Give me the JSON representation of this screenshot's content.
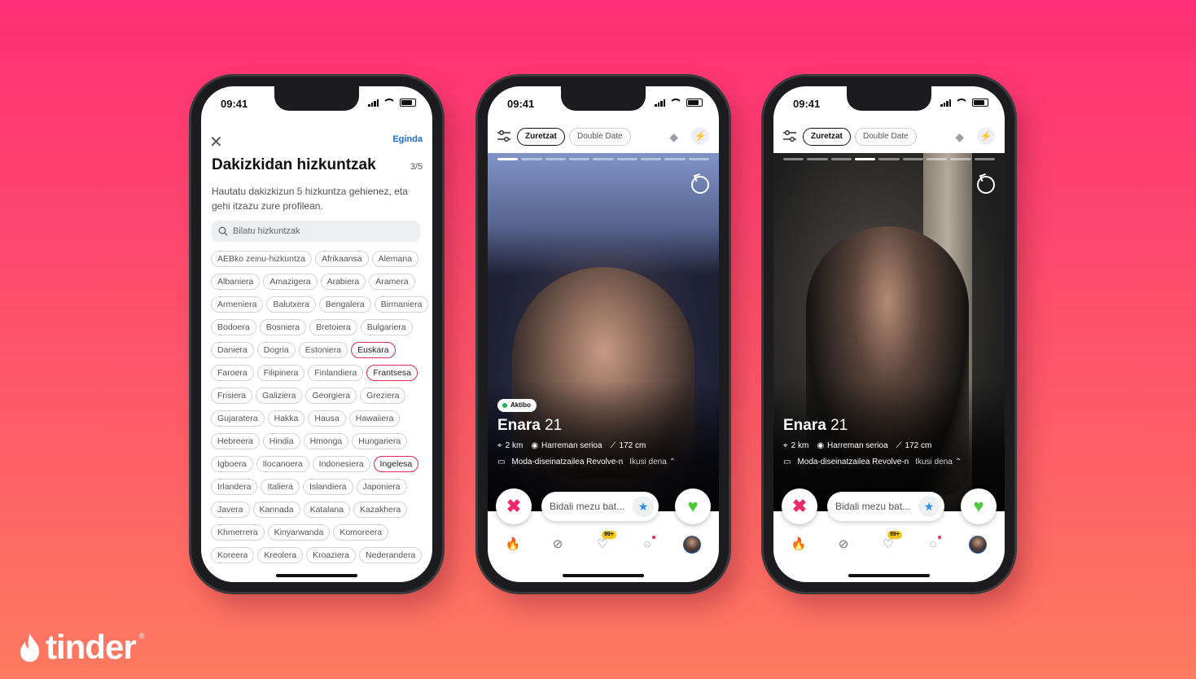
{
  "brand": {
    "wordmark": "tinder",
    "registered": "®"
  },
  "status": {
    "time": "09:41"
  },
  "languages_screen": {
    "close": "✕",
    "done": "Egindа",
    "title": "Dakizkidan hizkuntzak",
    "counter": "3/5",
    "description": "Hautatu dakizkizun 5 hizkuntza gehienez, eta gehi itzazu zure profilean.",
    "search_placeholder": "Bilatu hizkuntzak",
    "languages": [
      {
        "label": "AEBko zeinu-hizkuntza",
        "selected": false
      },
      {
        "label": "Afrikaansa",
        "selected": false
      },
      {
        "label": "Alemana",
        "selected": false
      },
      {
        "label": "Albaniera",
        "selected": false
      },
      {
        "label": "Amazigera",
        "selected": false
      },
      {
        "label": "Arabiera",
        "selected": false
      },
      {
        "label": "Aramera",
        "selected": false
      },
      {
        "label": "Armeniera",
        "selected": false
      },
      {
        "label": "Balutxera",
        "selected": false
      },
      {
        "label": "Bengalera",
        "selected": false
      },
      {
        "label": "Birmaniera",
        "selected": false
      },
      {
        "label": "Bodoera",
        "selected": false
      },
      {
        "label": "Bosniera",
        "selected": false
      },
      {
        "label": "Bretoiera",
        "selected": false
      },
      {
        "label": "Bulgariera",
        "selected": false
      },
      {
        "label": "Daniera",
        "selected": false
      },
      {
        "label": "Dogria",
        "selected": false
      },
      {
        "label": "Estoniera",
        "selected": false
      },
      {
        "label": "Euskara",
        "selected": true
      },
      {
        "label": "Faroera",
        "selected": false
      },
      {
        "label": "Filipinera",
        "selected": false
      },
      {
        "label": "Finlandiera",
        "selected": false
      },
      {
        "label": "Frantsesa",
        "selected": true
      },
      {
        "label": "Frisiera",
        "selected": false
      },
      {
        "label": "Galiziera",
        "selected": false
      },
      {
        "label": "Georgiera",
        "selected": false
      },
      {
        "label": "Greziera",
        "selected": false
      },
      {
        "label": "Gujaratera",
        "selected": false
      },
      {
        "label": "Hakka",
        "selected": false
      },
      {
        "label": "Hausa",
        "selected": false
      },
      {
        "label": "Hawaiiera",
        "selected": false
      },
      {
        "label": "Hebreera",
        "selected": false
      },
      {
        "label": "Hindia",
        "selected": false
      },
      {
        "label": "Hmonga",
        "selected": false
      },
      {
        "label": "Hungariera",
        "selected": false
      },
      {
        "label": "Igboera",
        "selected": false
      },
      {
        "label": "Ilocanoera",
        "selected": false
      },
      {
        "label": "Indonesiera",
        "selected": false
      },
      {
        "label": "Ingelesa",
        "selected": true
      },
      {
        "label": "Irlandera",
        "selected": false
      },
      {
        "label": "Italiera",
        "selected": false
      },
      {
        "label": "Islandiera",
        "selected": false
      },
      {
        "label": "Japoniera",
        "selected": false
      },
      {
        "label": "Javera",
        "selected": false
      },
      {
        "label": "Kannada",
        "selected": false
      },
      {
        "label": "Katalana",
        "selected": false
      },
      {
        "label": "Kazakhera",
        "selected": false
      },
      {
        "label": "Khmerrera",
        "selected": false
      },
      {
        "label": "Kinyarwanda",
        "selected": false
      },
      {
        "label": "Komoreera",
        "selected": false
      },
      {
        "label": "Koreera",
        "selected": false
      },
      {
        "label": "Kreolera",
        "selected": false
      },
      {
        "label": "Kroaziera",
        "selected": false
      },
      {
        "label": "Nederandera",
        "selected": false
      }
    ]
  },
  "profile_screen": {
    "tab_active": "Zuretzat",
    "tab_inactive": "Double Date",
    "active_badge": "Aktibo",
    "name": "Enara",
    "age": "21",
    "distance": "2 km",
    "looking_for": "Harreman serioa",
    "height": "172 cm",
    "job": "Moda-diseinatzailea Revolve-n",
    "see_all": "Ikusi dena",
    "message_placeholder": "Bidali mezu bat...",
    "likes_badge": "99+",
    "nope_icon": "✖",
    "like_icon": "♥",
    "superlike_icon": "★"
  },
  "photo_progress": {
    "segments": 9,
    "phone2_current": 0,
    "phone3_current": 3
  },
  "colors": {
    "accent": "#fd2f76",
    "selected_border": "#e0285a",
    "link": "#1b6bd6",
    "like": "#4fc83b",
    "nope": "#ef2a6a"
  }
}
